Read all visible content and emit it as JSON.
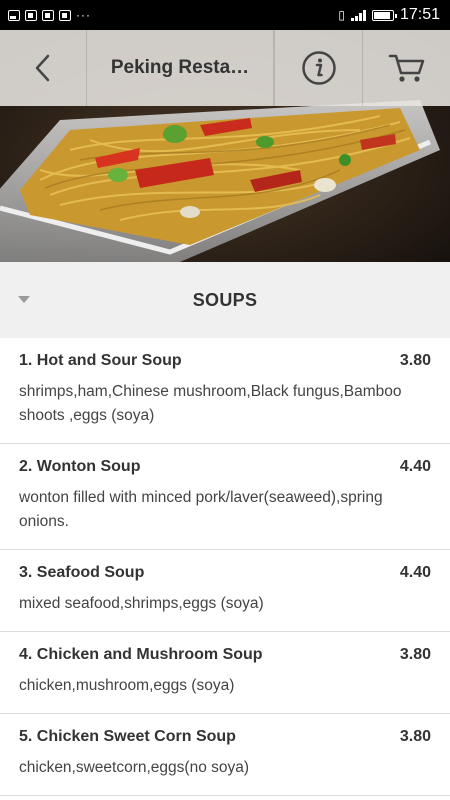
{
  "status_bar": {
    "time": "17:51",
    "notification_icons": [
      "image-icon",
      "square-icon",
      "square-icon",
      "square-icon"
    ],
    "overflow": "···"
  },
  "header": {
    "title": "Peking Resta…",
    "back_icon": "chevron-left-icon",
    "info_icon": "info-icon",
    "cart_icon": "cart-icon"
  },
  "section": {
    "title": "SOUPS",
    "expand_icon": "caret-down-icon"
  },
  "menu_items": [
    {
      "name": "1. Hot and Sour Soup",
      "price": "3.80",
      "description": "shrimps,ham,Chinese mushroom,Black fungus,Bamboo shoots ,eggs (soya)"
    },
    {
      "name": "2. Wonton Soup",
      "price": "4.40",
      "description": "wonton filled with minced pork/laver(seaweed),spring onions."
    },
    {
      "name": "3. Seafood Soup",
      "price": "4.40",
      "description": "mixed seafood,shrimps,eggs (soya)"
    },
    {
      "name": "4. Chicken and Mushroom Soup",
      "price": "3.80",
      "description": "chicken,mushroom,eggs (soya)"
    },
    {
      "name": "5. Chicken Sweet Corn Soup",
      "price": "3.80",
      "description": "chicken,sweetcorn,eggs(no soya)"
    }
  ]
}
